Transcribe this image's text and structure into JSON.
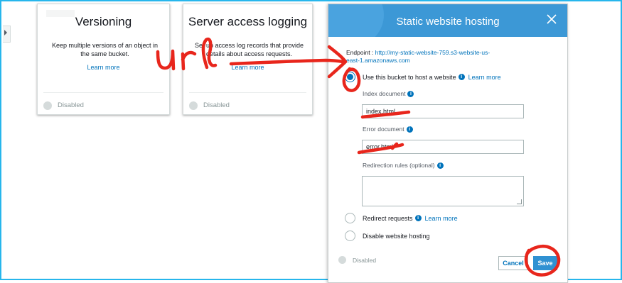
{
  "left_tab": {
    "icon": "caret-right-icon"
  },
  "cards": [
    {
      "title": "Versioning",
      "desc": "Keep multiple versions of an object in the same bucket.",
      "link": "Learn more",
      "status": "Disabled"
    },
    {
      "title": "Server access logging",
      "desc": "Set up access log records that provide details about access requests.",
      "link": "Learn more",
      "status": "Disabled"
    }
  ],
  "panel": {
    "title": "Static website hosting",
    "endpoint_label": "Endpoint : ",
    "endpoint_url": "http://my-static-website-759.s3-website-us-east-1.amazonaws.com",
    "use_bucket_label": "Use this bucket to host a website",
    "learn_more": "Learn more",
    "index_label": "Index document",
    "index_value": "index.html",
    "error_label": "Error document",
    "error_value": "error.html",
    "redirection_label": "Redirection rules (optional)",
    "redirect_label": "Redirect requests",
    "redirect_learn_more": "Learn more",
    "disable_label": "Disable website hosting",
    "status": "Disabled",
    "cancel": "Cancel",
    "save": "Save"
  },
  "annotation": {
    "handwritten_text": "url",
    "color": "#e8261c"
  },
  "colors": {
    "frame": "#27b6ec",
    "header": "#3c98d6",
    "link": "#0073bb",
    "save": "#2f91d2"
  }
}
